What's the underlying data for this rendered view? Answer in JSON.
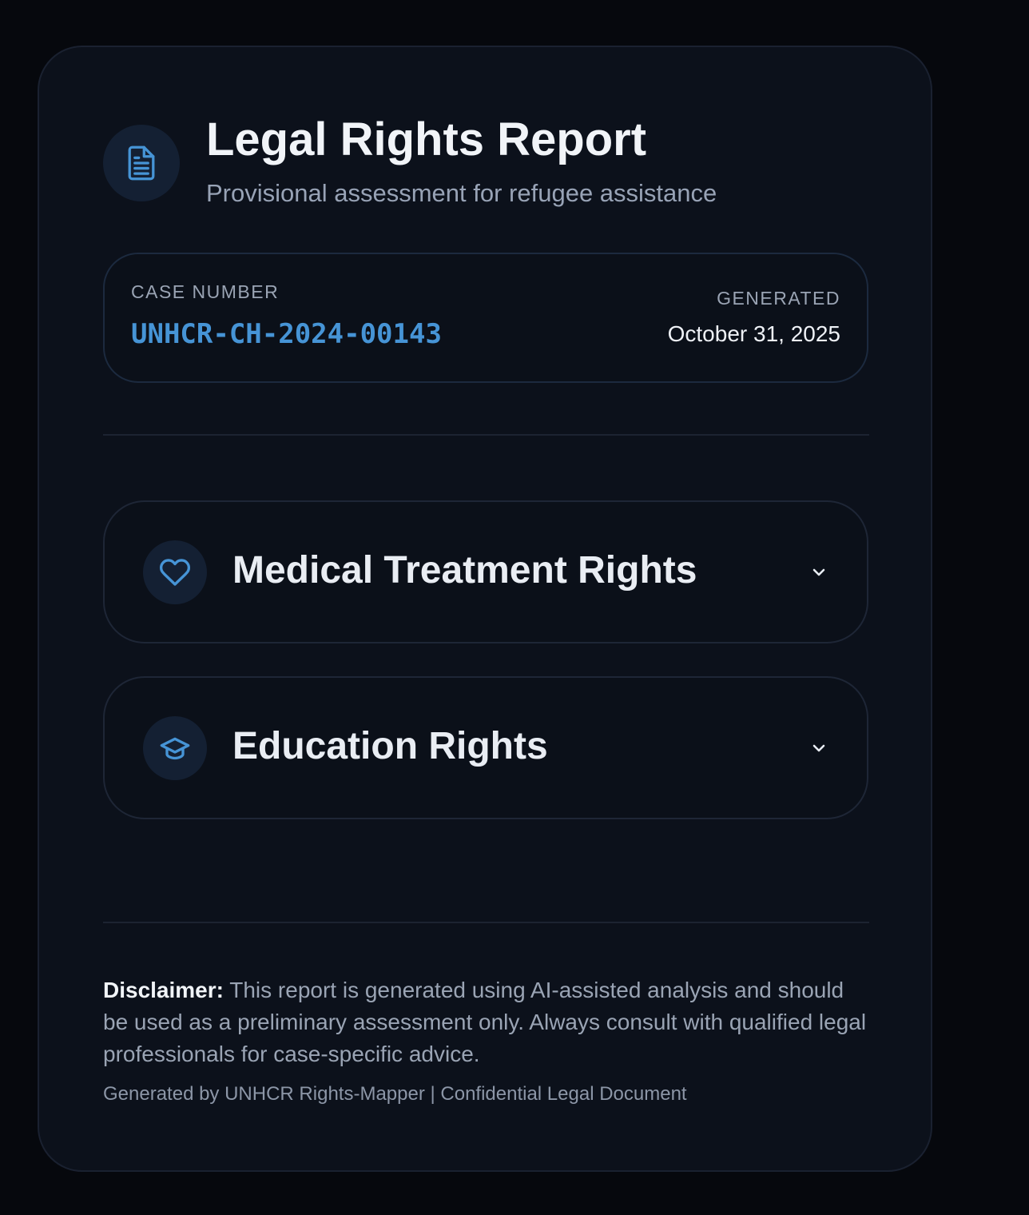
{
  "header": {
    "icon": "document-icon",
    "title": "Legal Rights Report",
    "subtitle": "Provisional assessment for refugee assistance"
  },
  "case": {
    "number_label": "CASE NUMBER",
    "number": "UNHCR-CH-2024-00143",
    "generated_label": "GENERATED",
    "generated_date": "October 31, 2025"
  },
  "sections": [
    {
      "icon": "heart-icon",
      "title": "Medical Treatment Rights",
      "expanded": false
    },
    {
      "icon": "graduation-cap-icon",
      "title": "Education Rights",
      "expanded": false
    }
  ],
  "disclaimer": {
    "label": "Disclaimer:",
    "text": "This report is generated using AI-assisted analysis and should be used as a preliminary assessment only. Always consult with qualified legal professionals for case-specific advice."
  },
  "footer": {
    "text": "Generated by UNHCR Rights-Mapper | Confidential Legal Document"
  },
  "colors": {
    "accent": "#4694d6",
    "background": "#06080d",
    "card": "#0c111b"
  }
}
